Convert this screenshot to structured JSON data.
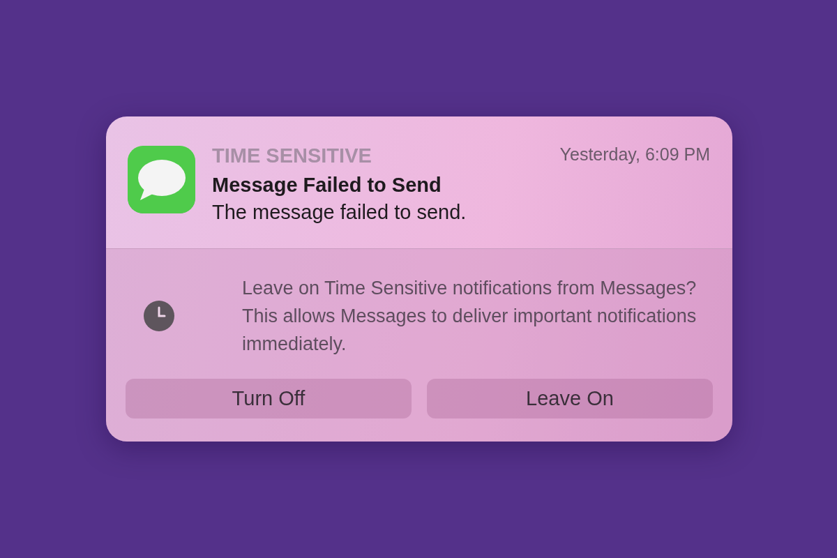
{
  "notification": {
    "category": "TIME SENSITIVE",
    "time": "Yesterday, 6:09 PM",
    "title": "Message Failed to Send",
    "body": "The message failed to send."
  },
  "prompt": {
    "text": "Leave on Time Sensitive notifications from Messages? This allows Messages to deliver important notifications immediately."
  },
  "buttons": [
    {
      "label": "Turn Off"
    },
    {
      "label": "Leave On"
    }
  ]
}
